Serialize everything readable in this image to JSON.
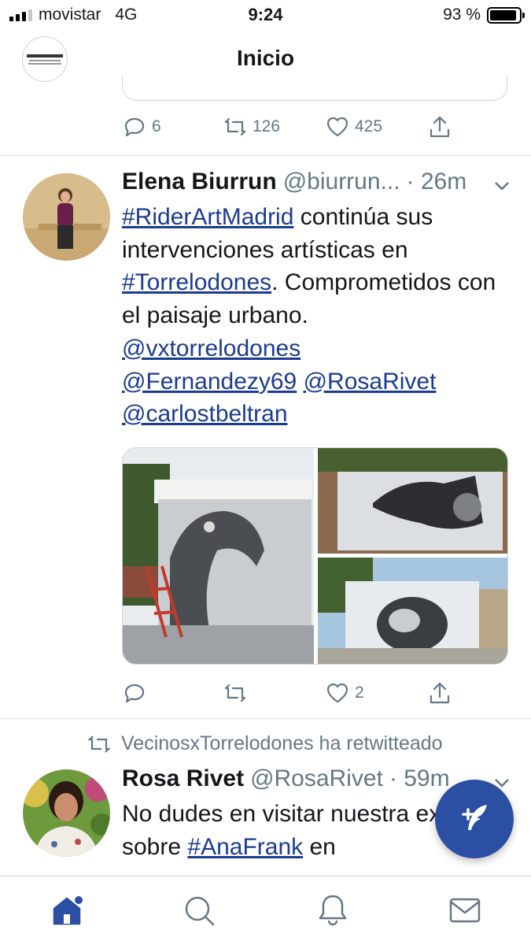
{
  "status_bar": {
    "carrier": "movistar",
    "network": "4G",
    "time": "9:24",
    "battery": "93 %",
    "battery_level": 0.93
  },
  "nav": {
    "title": "Inicio"
  },
  "previous_tweet": {
    "replies": "6",
    "retweets": "126",
    "likes": "425"
  },
  "tweet1": {
    "name": "Elena Biurrun",
    "handle": "@biurrun...",
    "time": "· 26m",
    "text_parts": {
      "hashtag1": "#RiderArtMadrid",
      "t1": " continúa sus intervenciones artísticas en ",
      "hashtag2": "#Torrelodones",
      "t2": ". Comprometidos con el paisaje urbano. ",
      "mention1": "@vxtorrelodones",
      "mention2": "@Fernandezy69",
      "mention3": "@RosaRivet",
      "mention4": "@carlostbeltran"
    },
    "likes": "2"
  },
  "retweet_context": {
    "text": "VecinosxTorrelodones ha retwitteado"
  },
  "tweet2": {
    "name": "Rosa Rivet",
    "handle": "@RosaRivet",
    "time": "· 59m",
    "text_parts": {
      "t1": "No dudes en visitar nuestra expo sobre ",
      "hashtag1": "#AnaFrank",
      "t2": " en"
    }
  },
  "colors": {
    "link": "#1b3c90",
    "secondary": "#657786",
    "accent": "#2a4fa3"
  }
}
